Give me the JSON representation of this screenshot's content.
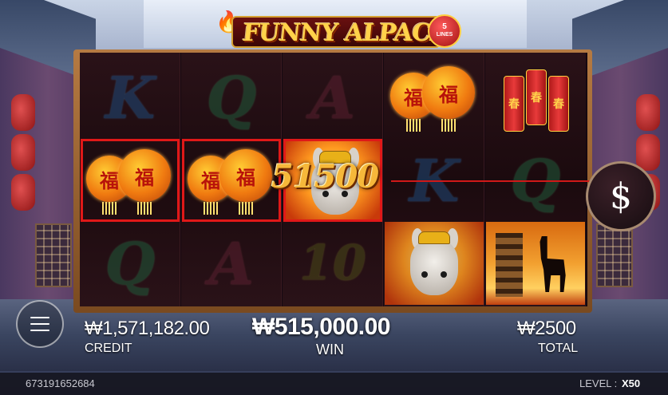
{
  "game": {
    "title": "FUNNY ALPACA",
    "lines_badge_number": "5",
    "lines_badge_text": "LINES"
  },
  "reels": [
    [
      "K",
      "lantern",
      "Q"
    ],
    [
      "Q",
      "lantern",
      "A"
    ],
    [
      "A",
      "alpaca",
      "10"
    ],
    [
      "lantern",
      "K",
      "alpaca"
    ],
    [
      "firecracker",
      "Q",
      "pagoda"
    ]
  ],
  "symbols": {
    "lantern_char": "福",
    "firecracker_chars": [
      "春",
      "春",
      "春"
    ]
  },
  "line_win": {
    "amount": "51500"
  },
  "credit": {
    "value": "₩1,571,182.00",
    "label": "CREDIT"
  },
  "win": {
    "value": "₩515,000.00",
    "label": "WIN"
  },
  "total": {
    "value": "₩2500",
    "label": "TOTAL"
  },
  "footer": {
    "round_id": "673191652684",
    "level_label": "LEVEL :",
    "level_value": "X50"
  },
  "icons": {
    "coin_button": "dollar-icon",
    "menu_button": "hamburger-icon"
  },
  "colors": {
    "win_highlight": "#e01818",
    "gold": "#f6b83a"
  }
}
